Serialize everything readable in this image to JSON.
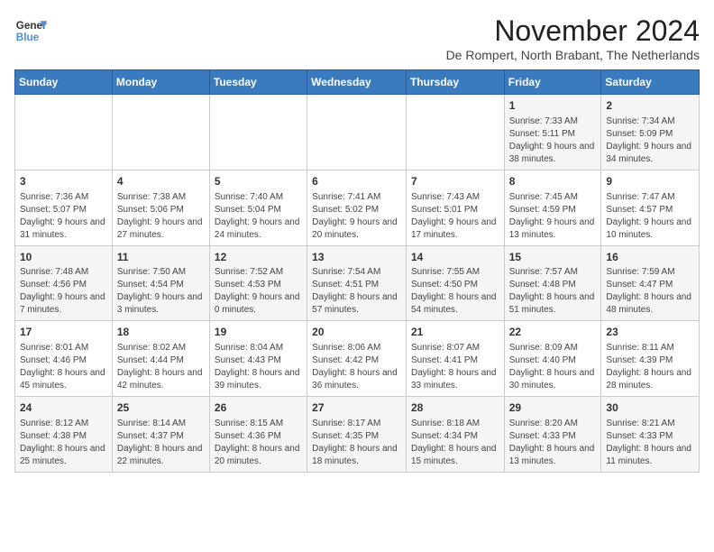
{
  "logo": {
    "line1": "General",
    "line2": "Blue"
  },
  "title": "November 2024",
  "location": "De Rompert, North Brabant, The Netherlands",
  "headers": [
    "Sunday",
    "Monday",
    "Tuesday",
    "Wednesday",
    "Thursday",
    "Friday",
    "Saturday"
  ],
  "weeks": [
    [
      {
        "day": "",
        "info": ""
      },
      {
        "day": "",
        "info": ""
      },
      {
        "day": "",
        "info": ""
      },
      {
        "day": "",
        "info": ""
      },
      {
        "day": "",
        "info": ""
      },
      {
        "day": "1",
        "info": "Sunrise: 7:33 AM\nSunset: 5:11 PM\nDaylight: 9 hours and 38 minutes."
      },
      {
        "day": "2",
        "info": "Sunrise: 7:34 AM\nSunset: 5:09 PM\nDaylight: 9 hours and 34 minutes."
      }
    ],
    [
      {
        "day": "3",
        "info": "Sunrise: 7:36 AM\nSunset: 5:07 PM\nDaylight: 9 hours and 31 minutes."
      },
      {
        "day": "4",
        "info": "Sunrise: 7:38 AM\nSunset: 5:06 PM\nDaylight: 9 hours and 27 minutes."
      },
      {
        "day": "5",
        "info": "Sunrise: 7:40 AM\nSunset: 5:04 PM\nDaylight: 9 hours and 24 minutes."
      },
      {
        "day": "6",
        "info": "Sunrise: 7:41 AM\nSunset: 5:02 PM\nDaylight: 9 hours and 20 minutes."
      },
      {
        "day": "7",
        "info": "Sunrise: 7:43 AM\nSunset: 5:01 PM\nDaylight: 9 hours and 17 minutes."
      },
      {
        "day": "8",
        "info": "Sunrise: 7:45 AM\nSunset: 4:59 PM\nDaylight: 9 hours and 13 minutes."
      },
      {
        "day": "9",
        "info": "Sunrise: 7:47 AM\nSunset: 4:57 PM\nDaylight: 9 hours and 10 minutes."
      }
    ],
    [
      {
        "day": "10",
        "info": "Sunrise: 7:48 AM\nSunset: 4:56 PM\nDaylight: 9 hours and 7 minutes."
      },
      {
        "day": "11",
        "info": "Sunrise: 7:50 AM\nSunset: 4:54 PM\nDaylight: 9 hours and 3 minutes."
      },
      {
        "day": "12",
        "info": "Sunrise: 7:52 AM\nSunset: 4:53 PM\nDaylight: 9 hours and 0 minutes."
      },
      {
        "day": "13",
        "info": "Sunrise: 7:54 AM\nSunset: 4:51 PM\nDaylight: 8 hours and 57 minutes."
      },
      {
        "day": "14",
        "info": "Sunrise: 7:55 AM\nSunset: 4:50 PM\nDaylight: 8 hours and 54 minutes."
      },
      {
        "day": "15",
        "info": "Sunrise: 7:57 AM\nSunset: 4:48 PM\nDaylight: 8 hours and 51 minutes."
      },
      {
        "day": "16",
        "info": "Sunrise: 7:59 AM\nSunset: 4:47 PM\nDaylight: 8 hours and 48 minutes."
      }
    ],
    [
      {
        "day": "17",
        "info": "Sunrise: 8:01 AM\nSunset: 4:46 PM\nDaylight: 8 hours and 45 minutes."
      },
      {
        "day": "18",
        "info": "Sunrise: 8:02 AM\nSunset: 4:44 PM\nDaylight: 8 hours and 42 minutes."
      },
      {
        "day": "19",
        "info": "Sunrise: 8:04 AM\nSunset: 4:43 PM\nDaylight: 8 hours and 39 minutes."
      },
      {
        "day": "20",
        "info": "Sunrise: 8:06 AM\nSunset: 4:42 PM\nDaylight: 8 hours and 36 minutes."
      },
      {
        "day": "21",
        "info": "Sunrise: 8:07 AM\nSunset: 4:41 PM\nDaylight: 8 hours and 33 minutes."
      },
      {
        "day": "22",
        "info": "Sunrise: 8:09 AM\nSunset: 4:40 PM\nDaylight: 8 hours and 30 minutes."
      },
      {
        "day": "23",
        "info": "Sunrise: 8:11 AM\nSunset: 4:39 PM\nDaylight: 8 hours and 28 minutes."
      }
    ],
    [
      {
        "day": "24",
        "info": "Sunrise: 8:12 AM\nSunset: 4:38 PM\nDaylight: 8 hours and 25 minutes."
      },
      {
        "day": "25",
        "info": "Sunrise: 8:14 AM\nSunset: 4:37 PM\nDaylight: 8 hours and 22 minutes."
      },
      {
        "day": "26",
        "info": "Sunrise: 8:15 AM\nSunset: 4:36 PM\nDaylight: 8 hours and 20 minutes."
      },
      {
        "day": "27",
        "info": "Sunrise: 8:17 AM\nSunset: 4:35 PM\nDaylight: 8 hours and 18 minutes."
      },
      {
        "day": "28",
        "info": "Sunrise: 8:18 AM\nSunset: 4:34 PM\nDaylight: 8 hours and 15 minutes."
      },
      {
        "day": "29",
        "info": "Sunrise: 8:20 AM\nSunset: 4:33 PM\nDaylight: 8 hours and 13 minutes."
      },
      {
        "day": "30",
        "info": "Sunrise: 8:21 AM\nSunset: 4:33 PM\nDaylight: 8 hours and 11 minutes."
      }
    ]
  ]
}
